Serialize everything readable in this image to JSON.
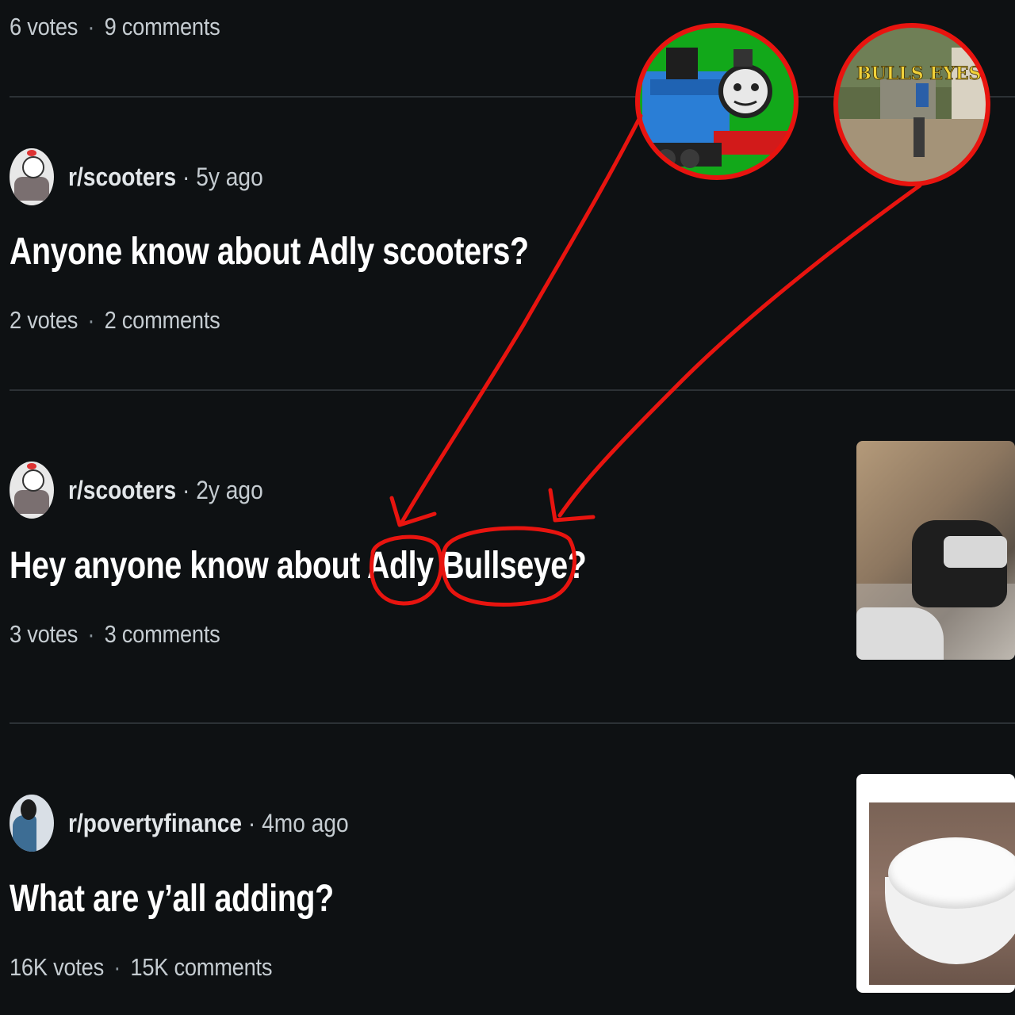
{
  "feed": {
    "top_meta": {
      "votes": "6 votes",
      "comments": "9 comments"
    },
    "posts": [
      {
        "subreddit": "r/scooters",
        "age": "5y ago",
        "title": "Anyone know about Adly scooters?",
        "votes": "2 votes",
        "comments": "2 comments"
      },
      {
        "subreddit": "r/scooters",
        "age": "2y ago",
        "title_before": "Hey anyone know about ",
        "title_word1": "Adly",
        "title_space": " ",
        "title_word2": "Bullseye",
        "title_after": "?",
        "votes": "3 votes",
        "comments": "3 comments"
      },
      {
        "subreddit": "r/povertyfinance",
        "age": "4mo ago",
        "title": "What are y’all adding?",
        "votes": "16K votes",
        "comments": "15K comments"
      }
    ]
  },
  "annotation": {
    "sign_text": "BULLS EYES",
    "stroke_color": "#e8140f"
  }
}
